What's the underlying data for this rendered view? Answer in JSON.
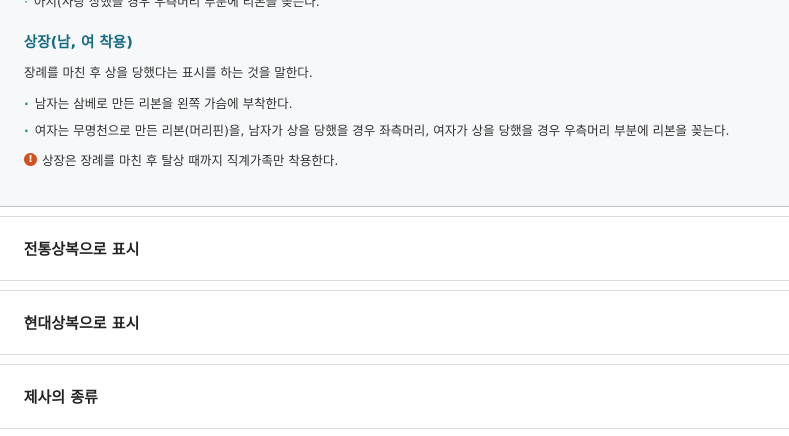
{
  "panel": {
    "clipped_line": "아지(사랑 상했을 경우 우측머리 부분에 리본을 꽂는다.",
    "section_title": "상장(남, 여 착용)",
    "description": "장례를 마친 후 상을 당했다는 표시를 하는 것을 말한다.",
    "bullets": [
      "남자는 삼베로 만든 리본을 왼쪽 가슴에 부착한다.",
      "여자는 무명천으로 만든 리본(머리핀)을, 남자가 상을 당했을 경우 좌측머리, 여자가 상을 당했을 경우 우측머리 부분에 리본을 꽂는다."
    ],
    "note": "상장은 장례를 마친 후 탈상 때까지 직계가족만 착용한다.",
    "bullet_symbol": "·",
    "note_icon": "exclamation-circle-icon",
    "colors": {
      "title": "#156a84",
      "bullet": "#1a8a96",
      "note_icon": "#d2521f",
      "panel_bg": "#f6f8fa"
    }
  },
  "accordion": [
    {
      "label": "전통상복으로 표시"
    },
    {
      "label": "현대상복으로 표시"
    },
    {
      "label": "제사의 종류"
    }
  ]
}
